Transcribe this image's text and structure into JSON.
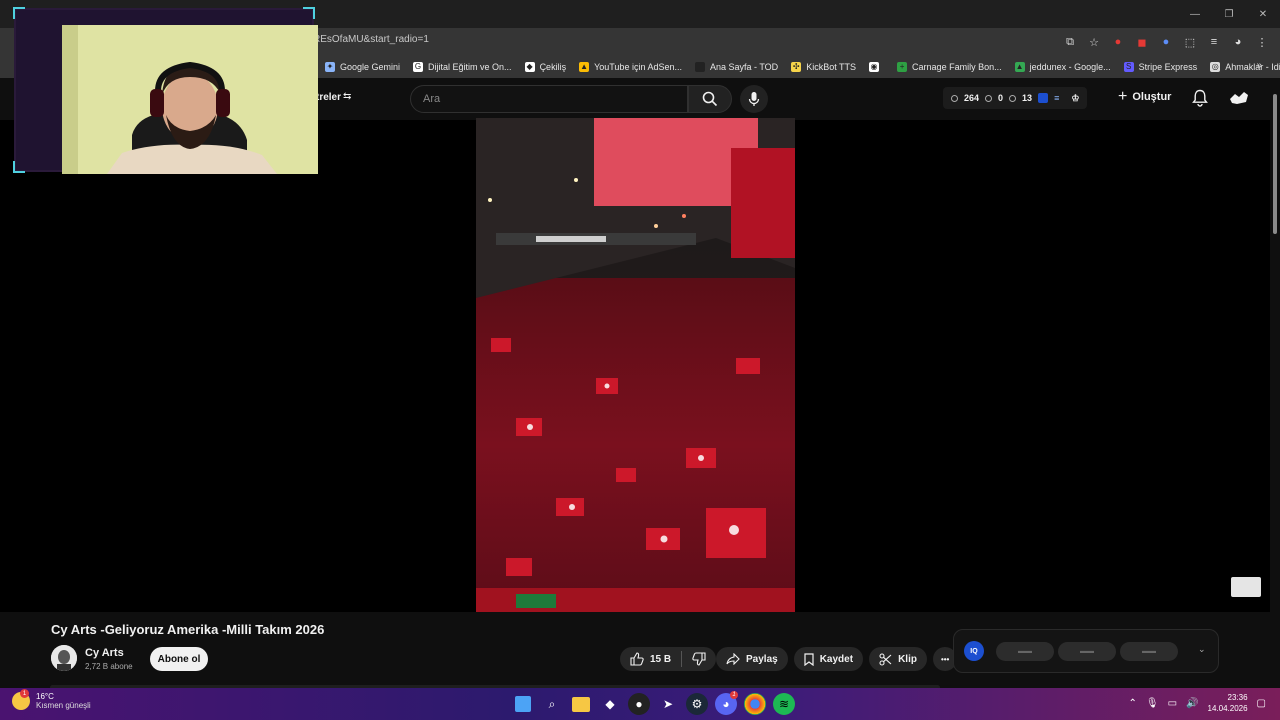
{
  "browser": {
    "url_fragment": "REsOfaMU&start_radio=1",
    "bookmarks": [
      {
        "label": "Google Gemini",
        "color": "#8ab4f8",
        "glyph": "✦"
      },
      {
        "label": "Dijital Eğitim ve On...",
        "color": "#ffffff",
        "glyph": "G"
      },
      {
        "label": "Çekiliş",
        "color": "#ffffff",
        "glyph": "◆"
      },
      {
        "label": "YouTube için AdSen...",
        "color": "#fbbc04",
        "glyph": "▲"
      },
      {
        "label": "Ana Sayfa - TOD",
        "color": "#222222",
        "glyph": "▪"
      },
      {
        "label": "KickBot TTS",
        "color": "#f6d44a",
        "glyph": "✣"
      },
      {
        "label": "",
        "color": "#ffffff",
        "glyph": "◉"
      },
      {
        "label": "Carnage Family Bon...",
        "color": "#2ea043",
        "glyph": "+"
      },
      {
        "label": "jeddunex - Google...",
        "color": "#34a853",
        "glyph": "▲"
      },
      {
        "label": "Stripe Express",
        "color": "#635bff",
        "glyph": "S"
      },
      {
        "label": "Ahmaklar - Idiocrac...",
        "color": "#dddddd",
        "glyph": "◎"
      }
    ]
  },
  "youtube": {
    "filters_label": "treler",
    "search_placeholder": "Ara",
    "stats": {
      "count_a": "264",
      "count_b": "0",
      "count_c": "13"
    },
    "create_label": "Oluştur"
  },
  "video": {
    "title": "Cy Arts -Geliyoruz Amerika -Milli Takım 2026",
    "channel_name": "Cy Arts",
    "subscribers": "2,72 B abone",
    "subscribe_label": "Abone ol",
    "likes": "15 B",
    "share_label": "Paylaş",
    "save_label": "Kaydet",
    "clip_label": "Klip",
    "more_label": "•••"
  },
  "extension": {
    "badge": "IQ",
    "slots": [
      "▬▬",
      "▬▬",
      "▬▬"
    ]
  },
  "taskbar": {
    "temperature": "16°C",
    "condition": "Kısmen güneşli",
    "weather_badge": "1",
    "chat_badge": "1",
    "time": "23:36",
    "date": "14.04.2026"
  },
  "colors": {
    "accent_red": "#c8102e",
    "webcam_border": "#4fd1e0",
    "taskbar_purple": "#3b1c7a"
  }
}
